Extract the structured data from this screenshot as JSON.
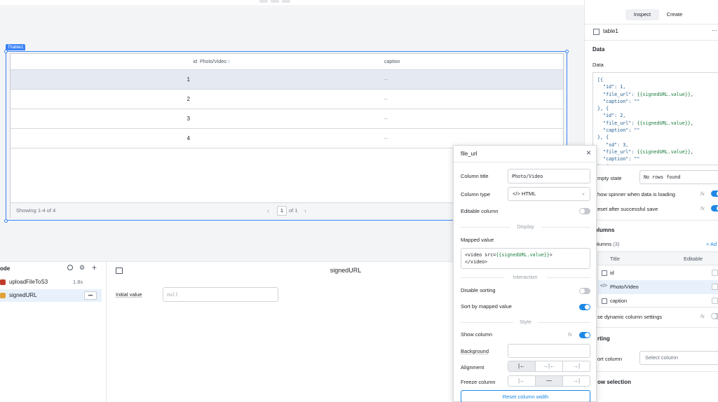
{
  "canvas": {
    "component_tag": "table1",
    "table": {
      "columns": [
        "id",
        "Photo/Video",
        "caption"
      ],
      "sort_indicator": "↑",
      "rows": [
        {
          "id": "1",
          "photo": "",
          "caption": "–"
        },
        {
          "id": "2",
          "photo": "",
          "caption": "–"
        },
        {
          "id": "3",
          "photo": "",
          "caption": "–"
        },
        {
          "id": "4",
          "photo": "",
          "caption": "–"
        }
      ],
      "footer": {
        "showing": "Showing 1-4 of 4",
        "prev": "‹",
        "page": "1",
        "of": "of 1",
        "next": "›"
      }
    }
  },
  "bottom": {
    "left": {
      "header": "ode",
      "items": [
        {
          "label": "uploadFileToS3",
          "meta": "1.8s"
        },
        {
          "label": "signedURL",
          "meta": "•••"
        }
      ]
    },
    "editor": {
      "title": "signedURL",
      "initial_value_label": "Initial value",
      "initial_value_placeholder": "null"
    }
  },
  "popup": {
    "title": "file_url",
    "close": "×",
    "column_title_label": "Column title",
    "column_title_value": "Photo/Video",
    "column_type_label": "Column type",
    "column_type_value": "</> HTML",
    "editable_label": "Editable column",
    "display_header": "Display",
    "mapped_value_label": "Mapped value",
    "mapped_value_prefix": "<video src=",
    "mapped_value_token": "{{signedURL.value}}",
    "mapped_value_suffix": ">",
    "mapped_value_line2": "</video>",
    "interaction_header": "Interaction",
    "disable_sorting_label": "Disable sorting",
    "sort_by_mapped_label": "Sort by mapped value",
    "style_header": "Style",
    "show_column_label": "Show column",
    "fx": "fx",
    "background_label": "Background",
    "alignment_label": "Alignment",
    "alignment_options": [
      "|←",
      "→|←",
      "→|"
    ],
    "freeze_label": "Freeze column",
    "freeze_options": [
      "|←",
      "—",
      "→|"
    ],
    "reset_width": "Reset column width",
    "toggles": {
      "editable": false,
      "disable_sorting": false,
      "sort_by_mapped": true,
      "show_column": true
    }
  },
  "inspector": {
    "tabs": [
      "Inspect",
      "Create"
    ],
    "component": "table1",
    "more": "···",
    "data_section": "Data",
    "data_label": "Data",
    "json_lines": [
      [
        "[{",
        "",
        ""
      ],
      [
        "  \"id\": 1,",
        "",
        ""
      ],
      [
        "  \"file_url\": ",
        "{{signedURL.value}}",
        ","
      ],
      [
        "  \"caption\": \"\"",
        "",
        ""
      ],
      [
        "}, {",
        "",
        ""
      ],
      [
        "  \"id\": 2,",
        "",
        ""
      ],
      [
        "  \"file_url\": ",
        "{{signedURL.value}}",
        ","
      ],
      [
        "  \"caption\": \"\"",
        "",
        ""
      ],
      [
        "}, {",
        "",
        ""
      ],
      [
        "   \"sd\": 3,",
        "",
        ""
      ],
      [
        "  \"file_url\": ",
        "{{signedURL.value}}",
        ","
      ],
      [
        "  \"caption\": \"\"",
        "",
        ""
      ],
      [
        "}, {",
        "",
        ""
      ]
    ],
    "empty_state_label": "mpty state",
    "empty_state_value": "No rows found",
    "spinner_label": "how spinner when data is loading",
    "reset_label": "eset after successful save",
    "columns_section": "olumns",
    "columns_label": "olumns",
    "columns_count": "(3)",
    "add": "+ Ad",
    "col_header_title": "Title",
    "col_header_editable": "Editable",
    "columns": [
      {
        "name": "id",
        "icon": "grid-icon"
      },
      {
        "name": "Photo/Video",
        "icon": "code-icon"
      },
      {
        "name": "caption",
        "icon": "grid-icon"
      }
    ],
    "dynamic_label": "se dynamic column settings",
    "sorting_section": "rting",
    "sort_column_label": "ort column",
    "sort_column_placeholder": "Select column",
    "row_selection_section": "ow selection"
  },
  "colors": {
    "accent": "#1e88e5",
    "selection": "#3b82f6",
    "row_selected": "#e5e9f1",
    "token": "#1c7c3d"
  }
}
